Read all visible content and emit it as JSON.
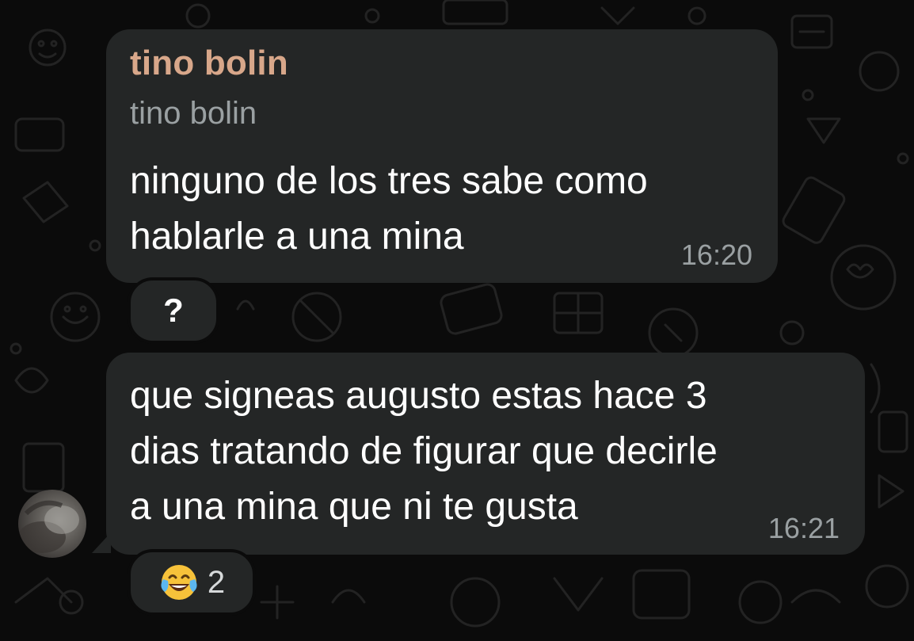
{
  "chat": {
    "messages": [
      {
        "sender": "tino bolin",
        "quote_author": "tino bolin",
        "lines": [
          "ninguno de los tres sabe como",
          "hablarle a una mina"
        ],
        "time": "16:20",
        "reaction": {
          "symbol": "?",
          "count": ""
        }
      },
      {
        "lines": [
          "que signeas augusto estas hace 3",
          "dias tratando de figurar que decirle",
          "a una mina que ni te gusta"
        ],
        "time": "16:21",
        "reaction": {
          "emoji": "face-with-tears-of-joy-icon",
          "count": "2"
        }
      }
    ]
  },
  "colors": {
    "background": "#0b0b0b",
    "bubble": "#242626",
    "sender_name": "#d8a78a",
    "meta_text": "#9aa0a2",
    "message_text": "#ffffff"
  }
}
